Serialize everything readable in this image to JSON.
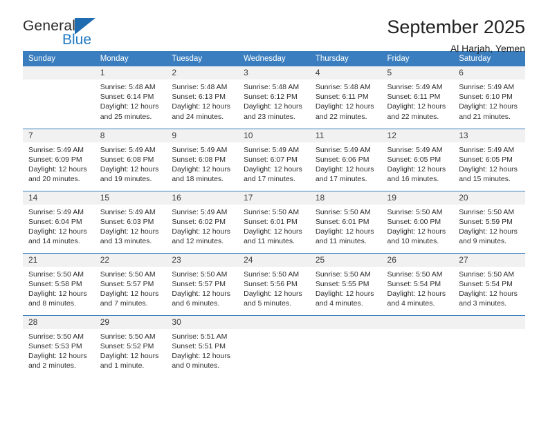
{
  "brand": {
    "name_top": "General",
    "name_bottom": "Blue",
    "triangle_color": "#1f6cb0",
    "blue_color": "#1f7ac4"
  },
  "header": {
    "title": "September 2025",
    "subtitle": "Al Harjah, Yemen"
  },
  "calendar": {
    "header_bg": "#3a7ebf",
    "daynum_bg": "#f1f1f1",
    "weekday_headers": [
      "Sunday",
      "Monday",
      "Tuesday",
      "Wednesday",
      "Thursday",
      "Friday",
      "Saturday"
    ],
    "weeks": [
      [
        {
          "day": "",
          "empty": true,
          "sunrise": "",
          "sunset": "",
          "daylight_line1": "",
          "daylight_line2": ""
        },
        {
          "day": "1",
          "empty": false,
          "sunrise": "Sunrise: 5:48 AM",
          "sunset": "Sunset: 6:14 PM",
          "daylight_line1": "Daylight: 12 hours",
          "daylight_line2": "and 25 minutes."
        },
        {
          "day": "2",
          "empty": false,
          "sunrise": "Sunrise: 5:48 AM",
          "sunset": "Sunset: 6:13 PM",
          "daylight_line1": "Daylight: 12 hours",
          "daylight_line2": "and 24 minutes."
        },
        {
          "day": "3",
          "empty": false,
          "sunrise": "Sunrise: 5:48 AM",
          "sunset": "Sunset: 6:12 PM",
          "daylight_line1": "Daylight: 12 hours",
          "daylight_line2": "and 23 minutes."
        },
        {
          "day": "4",
          "empty": false,
          "sunrise": "Sunrise: 5:48 AM",
          "sunset": "Sunset: 6:11 PM",
          "daylight_line1": "Daylight: 12 hours",
          "daylight_line2": "and 22 minutes."
        },
        {
          "day": "5",
          "empty": false,
          "sunrise": "Sunrise: 5:49 AM",
          "sunset": "Sunset: 6:11 PM",
          "daylight_line1": "Daylight: 12 hours",
          "daylight_line2": "and 22 minutes."
        },
        {
          "day": "6",
          "empty": false,
          "sunrise": "Sunrise: 5:49 AM",
          "sunset": "Sunset: 6:10 PM",
          "daylight_line1": "Daylight: 12 hours",
          "daylight_line2": "and 21 minutes."
        }
      ],
      [
        {
          "day": "7",
          "empty": false,
          "sunrise": "Sunrise: 5:49 AM",
          "sunset": "Sunset: 6:09 PM",
          "daylight_line1": "Daylight: 12 hours",
          "daylight_line2": "and 20 minutes."
        },
        {
          "day": "8",
          "empty": false,
          "sunrise": "Sunrise: 5:49 AM",
          "sunset": "Sunset: 6:08 PM",
          "daylight_line1": "Daylight: 12 hours",
          "daylight_line2": "and 19 minutes."
        },
        {
          "day": "9",
          "empty": false,
          "sunrise": "Sunrise: 5:49 AM",
          "sunset": "Sunset: 6:08 PM",
          "daylight_line1": "Daylight: 12 hours",
          "daylight_line2": "and 18 minutes."
        },
        {
          "day": "10",
          "empty": false,
          "sunrise": "Sunrise: 5:49 AM",
          "sunset": "Sunset: 6:07 PM",
          "daylight_line1": "Daylight: 12 hours",
          "daylight_line2": "and 17 minutes."
        },
        {
          "day": "11",
          "empty": false,
          "sunrise": "Sunrise: 5:49 AM",
          "sunset": "Sunset: 6:06 PM",
          "daylight_line1": "Daylight: 12 hours",
          "daylight_line2": "and 17 minutes."
        },
        {
          "day": "12",
          "empty": false,
          "sunrise": "Sunrise: 5:49 AM",
          "sunset": "Sunset: 6:05 PM",
          "daylight_line1": "Daylight: 12 hours",
          "daylight_line2": "and 16 minutes."
        },
        {
          "day": "13",
          "empty": false,
          "sunrise": "Sunrise: 5:49 AM",
          "sunset": "Sunset: 6:05 PM",
          "daylight_line1": "Daylight: 12 hours",
          "daylight_line2": "and 15 minutes."
        }
      ],
      [
        {
          "day": "14",
          "empty": false,
          "sunrise": "Sunrise: 5:49 AM",
          "sunset": "Sunset: 6:04 PM",
          "daylight_line1": "Daylight: 12 hours",
          "daylight_line2": "and 14 minutes."
        },
        {
          "day": "15",
          "empty": false,
          "sunrise": "Sunrise: 5:49 AM",
          "sunset": "Sunset: 6:03 PM",
          "daylight_line1": "Daylight: 12 hours",
          "daylight_line2": "and 13 minutes."
        },
        {
          "day": "16",
          "empty": false,
          "sunrise": "Sunrise: 5:49 AM",
          "sunset": "Sunset: 6:02 PM",
          "daylight_line1": "Daylight: 12 hours",
          "daylight_line2": "and 12 minutes."
        },
        {
          "day": "17",
          "empty": false,
          "sunrise": "Sunrise: 5:50 AM",
          "sunset": "Sunset: 6:01 PM",
          "daylight_line1": "Daylight: 12 hours",
          "daylight_line2": "and 11 minutes."
        },
        {
          "day": "18",
          "empty": false,
          "sunrise": "Sunrise: 5:50 AM",
          "sunset": "Sunset: 6:01 PM",
          "daylight_line1": "Daylight: 12 hours",
          "daylight_line2": "and 11 minutes."
        },
        {
          "day": "19",
          "empty": false,
          "sunrise": "Sunrise: 5:50 AM",
          "sunset": "Sunset: 6:00 PM",
          "daylight_line1": "Daylight: 12 hours",
          "daylight_line2": "and 10 minutes."
        },
        {
          "day": "20",
          "empty": false,
          "sunrise": "Sunrise: 5:50 AM",
          "sunset": "Sunset: 5:59 PM",
          "daylight_line1": "Daylight: 12 hours",
          "daylight_line2": "and 9 minutes."
        }
      ],
      [
        {
          "day": "21",
          "empty": false,
          "sunrise": "Sunrise: 5:50 AM",
          "sunset": "Sunset: 5:58 PM",
          "daylight_line1": "Daylight: 12 hours",
          "daylight_line2": "and 8 minutes."
        },
        {
          "day": "22",
          "empty": false,
          "sunrise": "Sunrise: 5:50 AM",
          "sunset": "Sunset: 5:57 PM",
          "daylight_line1": "Daylight: 12 hours",
          "daylight_line2": "and 7 minutes."
        },
        {
          "day": "23",
          "empty": false,
          "sunrise": "Sunrise: 5:50 AM",
          "sunset": "Sunset: 5:57 PM",
          "daylight_line1": "Daylight: 12 hours",
          "daylight_line2": "and 6 minutes."
        },
        {
          "day": "24",
          "empty": false,
          "sunrise": "Sunrise: 5:50 AM",
          "sunset": "Sunset: 5:56 PM",
          "daylight_line1": "Daylight: 12 hours",
          "daylight_line2": "and 5 minutes."
        },
        {
          "day": "25",
          "empty": false,
          "sunrise": "Sunrise: 5:50 AM",
          "sunset": "Sunset: 5:55 PM",
          "daylight_line1": "Daylight: 12 hours",
          "daylight_line2": "and 4 minutes."
        },
        {
          "day": "26",
          "empty": false,
          "sunrise": "Sunrise: 5:50 AM",
          "sunset": "Sunset: 5:54 PM",
          "daylight_line1": "Daylight: 12 hours",
          "daylight_line2": "and 4 minutes."
        },
        {
          "day": "27",
          "empty": false,
          "sunrise": "Sunrise: 5:50 AM",
          "sunset": "Sunset: 5:54 PM",
          "daylight_line1": "Daylight: 12 hours",
          "daylight_line2": "and 3 minutes."
        }
      ],
      [
        {
          "day": "28",
          "empty": false,
          "sunrise": "Sunrise: 5:50 AM",
          "sunset": "Sunset: 5:53 PM",
          "daylight_line1": "Daylight: 12 hours",
          "daylight_line2": "and 2 minutes."
        },
        {
          "day": "29",
          "empty": false,
          "sunrise": "Sunrise: 5:50 AM",
          "sunset": "Sunset: 5:52 PM",
          "daylight_line1": "Daylight: 12 hours",
          "daylight_line2": "and 1 minute."
        },
        {
          "day": "30",
          "empty": false,
          "sunrise": "Sunrise: 5:51 AM",
          "sunset": "Sunset: 5:51 PM",
          "daylight_line1": "Daylight: 12 hours",
          "daylight_line2": "and 0 minutes."
        },
        {
          "day": "",
          "empty": true,
          "sunrise": "",
          "sunset": "",
          "daylight_line1": "",
          "daylight_line2": ""
        },
        {
          "day": "",
          "empty": true,
          "sunrise": "",
          "sunset": "",
          "daylight_line1": "",
          "daylight_line2": ""
        },
        {
          "day": "",
          "empty": true,
          "sunrise": "",
          "sunset": "",
          "daylight_line1": "",
          "daylight_line2": ""
        },
        {
          "day": "",
          "empty": true,
          "sunrise": "",
          "sunset": "",
          "daylight_line1": "",
          "daylight_line2": ""
        }
      ]
    ]
  }
}
